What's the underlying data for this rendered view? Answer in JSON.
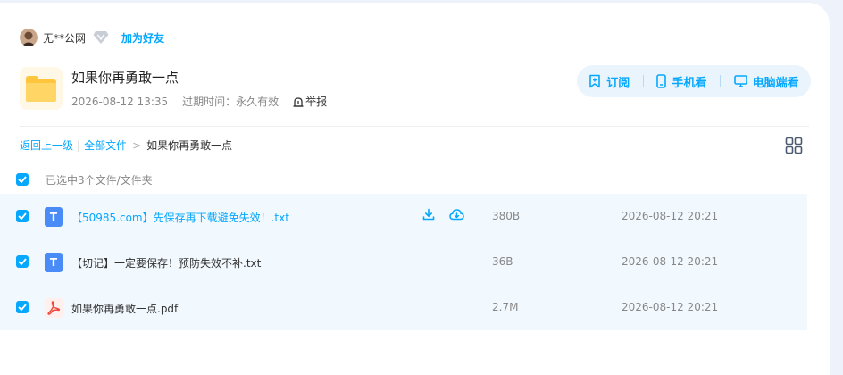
{
  "owner": {
    "name": "无**公网",
    "add_friend": "加为好友"
  },
  "share": {
    "title": "如果你再勇敢一点",
    "created": "2026-08-12 13:35",
    "expiry_label": "过期时间：",
    "expiry_value": "永久有效",
    "report": "举报"
  },
  "actions": {
    "subscribe": "订阅",
    "mobile": "手机看",
    "desktop": "电脑端看"
  },
  "breadcrumb": {
    "back": "返回上一级",
    "all_files": "全部文件",
    "current": "如果你再勇敢一点"
  },
  "selection": {
    "text": "已选中3个文件/文件夹"
  },
  "files": [
    {
      "name": "【50985.com】先保存再下载避免失效！.txt",
      "type": "txt",
      "size": "380B",
      "date": "2026-08-12 20:21",
      "checked": true
    },
    {
      "name": "【切记】一定要保存！预防失效不补.txt",
      "type": "txt",
      "size": "36B",
      "date": "2026-08-12 20:21",
      "checked": true
    },
    {
      "name": "如果你再勇敢一点.pdf",
      "type": "pdf",
      "size": "2.7M",
      "date": "2026-08-12 20:21",
      "checked": true
    }
  ],
  "icons": {
    "txt_glyph": "T",
    "accent": "#06a7ff"
  }
}
